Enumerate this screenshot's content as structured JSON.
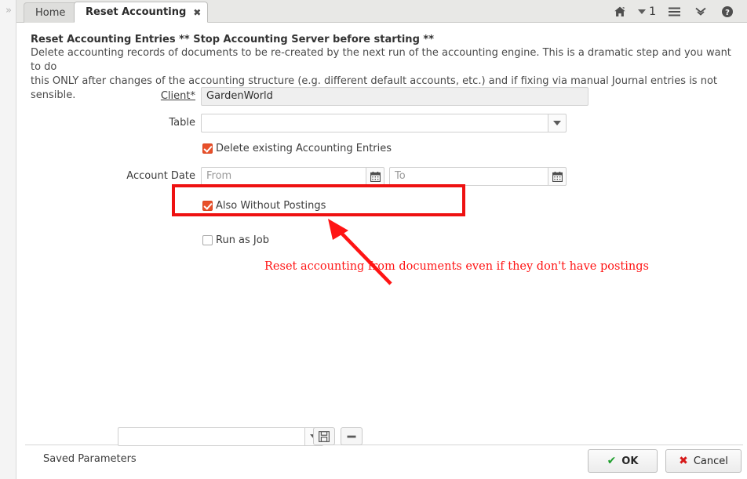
{
  "window": {
    "left_rail_expand_icon": "chevrons-right-icon"
  },
  "tabs": [
    {
      "label": "Home",
      "active": false
    },
    {
      "label": "Reset Accounting",
      "active": true,
      "close": "✖"
    }
  ],
  "toolbar": {
    "home_icon": "home-icon",
    "record_count": "1",
    "dropdown_icon": "caret-down-icon",
    "menu_icon": "hamburger-menu-icon",
    "expand_icon": "double-chevron-down-icon",
    "help_icon": "help-question-icon"
  },
  "header": {
    "title": "Reset Accounting Entries ** Stop Accounting Server before starting **",
    "description_line1": "Delete accounting records of documents to be re-created by the next run of the accounting engine. This is a dramatic step and you want to do",
    "description_line2": "this ONLY after changes of the accounting structure (e.g. different default accounts, etc.) and if fixing via manual Journal entries is not sensible."
  },
  "form": {
    "client": {
      "label": "Client*",
      "value": "GardenWorld"
    },
    "table": {
      "label": "Table",
      "value": "",
      "placeholder": ""
    },
    "delete_existing": {
      "label": "Delete existing Accounting Entries",
      "checked": true
    },
    "account_date": {
      "label": "Account Date",
      "from_value": "",
      "from_placeholder": "From",
      "to_value": "",
      "to_placeholder": "To",
      "calendar_icon": "calendar-icon"
    },
    "also_without_postings": {
      "label": "Also Without Postings",
      "checked": true
    },
    "run_as_job": {
      "label": "Run as Job",
      "checked": false
    }
  },
  "annotation": {
    "text": "Reset accounting from documents even if they don't have postings",
    "color": "#ff1414"
  },
  "bottom": {
    "saved_parameters_label": "Saved Parameters",
    "saved_parameters_value": "",
    "save_icon": "floppy-disk-icon",
    "delete_icon": "minus-icon",
    "ok_label": "OK",
    "ok_icon": "✔",
    "cancel_label": "Cancel",
    "cancel_icon": "✖"
  }
}
